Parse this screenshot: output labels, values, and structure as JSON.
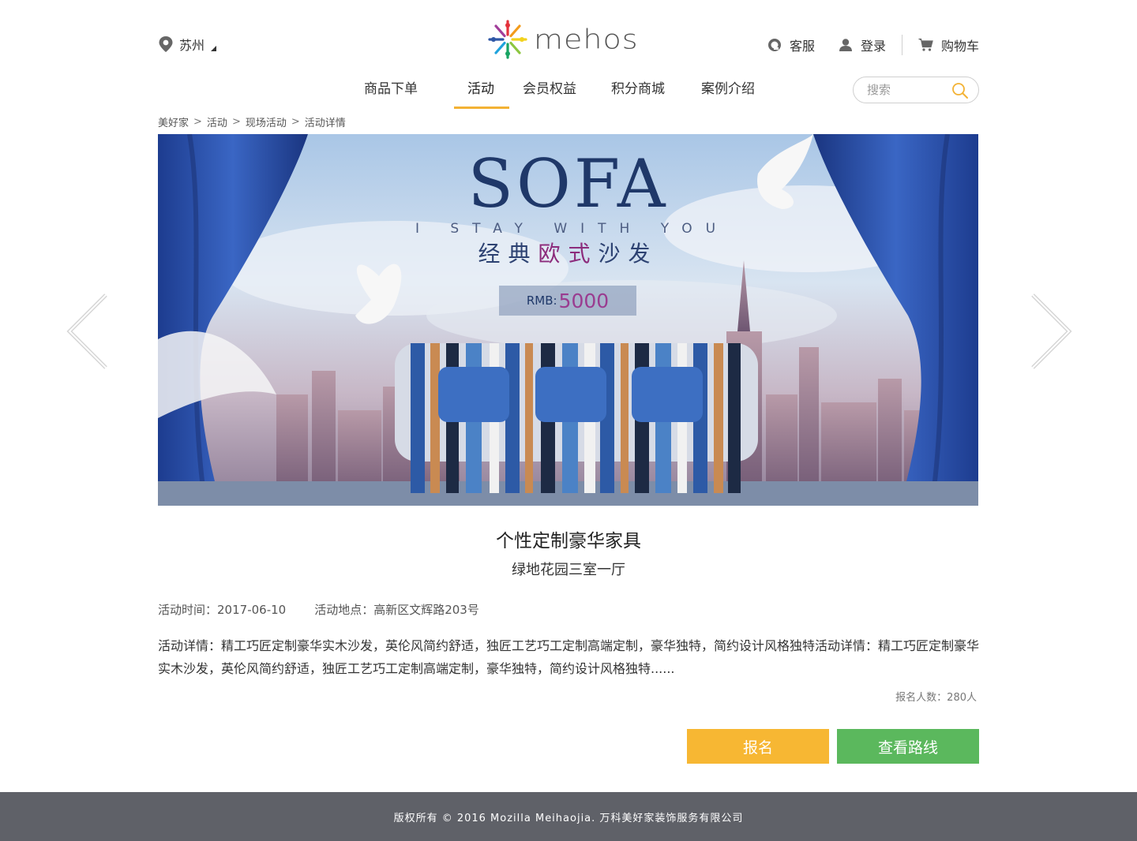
{
  "header": {
    "city": "苏州",
    "logo_text": "mehos",
    "service": "客服",
    "login": "登录",
    "cart": "购物车"
  },
  "nav": {
    "items": [
      "商品下单",
      "活动",
      "会员权益",
      "积分商城",
      "案例介绍"
    ],
    "active": "活动"
  },
  "search": {
    "placeholder": "搜索"
  },
  "breadcrumb": [
    "美好家",
    "活动",
    "现场活动",
    "活动详情"
  ],
  "banner": {
    "title": "SOFA",
    "tagline": "I STAY WITH YOU",
    "cn_title_a": "经典",
    "cn_title_b": "欧式",
    "cn_title_c": "沙发",
    "price_prefix": "RMB:",
    "price_value": "5000"
  },
  "activity": {
    "title": "个性定制豪华家具",
    "subtitle": "绿地花园三室一厅",
    "time_label": "活动时间：",
    "time_value": "2017-06-10",
    "place_label": "活动地点：",
    "place_value": "高新区文辉路203号",
    "description": "活动详情：精工巧匠定制豪华实木沙发，英伦风简约舒适，独匠工艺巧工定制高端定制，豪华独特，简约设计风格独特活动详情：精工巧匠定制豪华实木沙发，英伦风简约舒适，独匠工艺巧工定制高端定制，豪华独特，简约设计风格独特......",
    "signup_count": "报名人数：280人"
  },
  "buttons": {
    "signup": "报名",
    "route": "查看路线"
  },
  "footer": {
    "copyright": "版权所有 © 2016 Mozilla Meihaojia. 万科美好家装饰服务有限公司"
  },
  "colors": {
    "accent": "#f3b234",
    "signup_button": "#f7b733",
    "route_button": "#5bb85d",
    "footer_bg": "#5f6168"
  },
  "icons": [
    "location-pin-icon",
    "headset-icon",
    "user-icon",
    "cart-icon",
    "search-icon",
    "chevron-left-icon",
    "chevron-right-icon"
  ]
}
